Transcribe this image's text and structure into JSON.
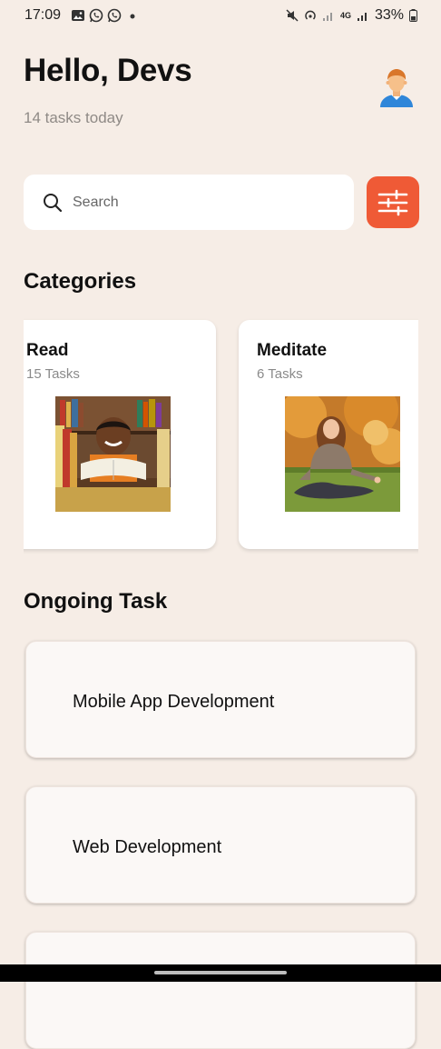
{
  "status_bar": {
    "time": "17:09",
    "battery": "33%",
    "network": "4G",
    "icons_left": [
      "gallery-icon",
      "whatsapp-icon",
      "whatsapp-icon",
      "dot-icon"
    ],
    "icons_right": [
      "mute-icon",
      "hotspot-icon",
      "signal-icon",
      "4g-icon",
      "signal-icon",
      "battery-icon"
    ]
  },
  "header": {
    "greeting": "Hello, Devs",
    "subtitle": "14 tasks today",
    "avatar_icon": "person-avatar-icon"
  },
  "search": {
    "placeholder": "Search",
    "icon": "search-icon",
    "filter_icon": "sliders-icon"
  },
  "categories": {
    "title": "Categories",
    "items": [
      {
        "title": "Read",
        "count": "15 Tasks",
        "image": "child-reading-book-photo"
      },
      {
        "title": "Meditate",
        "count": "6 Tasks",
        "image": "woman-meditating-photo"
      }
    ]
  },
  "ongoing": {
    "title": "Ongoing Task",
    "tasks": [
      {
        "name": "Mobile App Development"
      },
      {
        "name": "Web Development"
      },
      {
        "name": ""
      }
    ]
  },
  "colors": {
    "background": "#f6ede6",
    "accent": "#ef5a36",
    "card": "#ffffff",
    "subtle_text": "#8f8a86"
  }
}
